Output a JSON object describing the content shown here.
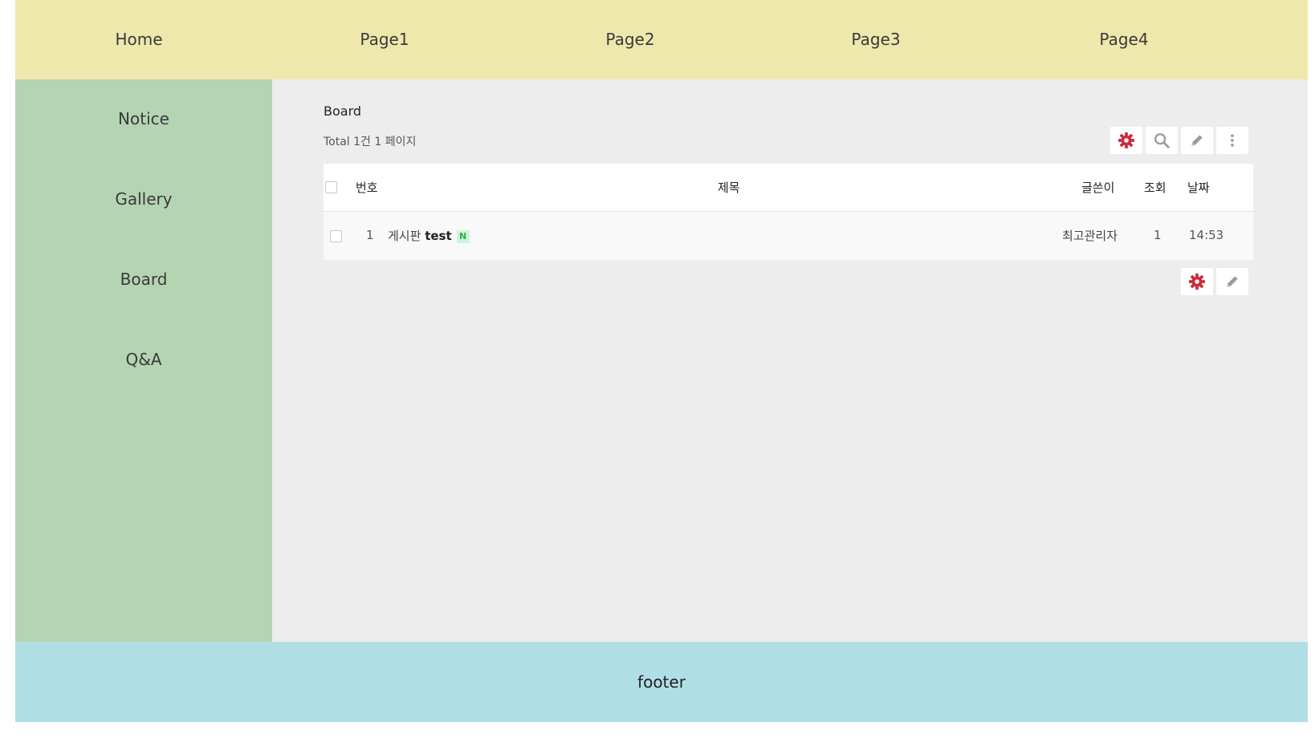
{
  "nav": {
    "items": [
      "Home",
      "Page1",
      "Page2",
      "Page3",
      "Page4"
    ]
  },
  "sidebar": {
    "items": [
      "Notice",
      "Gallery",
      "Board",
      "Q&A"
    ]
  },
  "board": {
    "title": "Board",
    "total": "Total 1건 1 페이지",
    "columns": {
      "num": "번호",
      "subject": "제목",
      "writer": "글쓴이",
      "views": "조회",
      "date": "날짜"
    },
    "rows": [
      {
        "num": "1",
        "category": "게시판",
        "subject": "test",
        "badge": "N",
        "writer": "최고관리자",
        "views": "1",
        "date": "14:53"
      }
    ]
  },
  "icons": {
    "top_toolbar": [
      "gear-icon",
      "search-icon",
      "pencil-icon",
      "more-vertical-icon"
    ],
    "bottom_toolbar": [
      "gear-icon",
      "pencil-icon"
    ]
  },
  "colors": {
    "header_bg": "#eee8ad",
    "sidebar_bg": "#b4d4b2",
    "main_bg": "#ededed",
    "footer_bg": "#b0dee5",
    "admin_icon": "#d0283a",
    "icon_gray": "#9a9a9a",
    "new_badge_bg": "#cff4d8",
    "new_badge_fg": "#2bb34a"
  },
  "footer": {
    "text": "footer"
  }
}
